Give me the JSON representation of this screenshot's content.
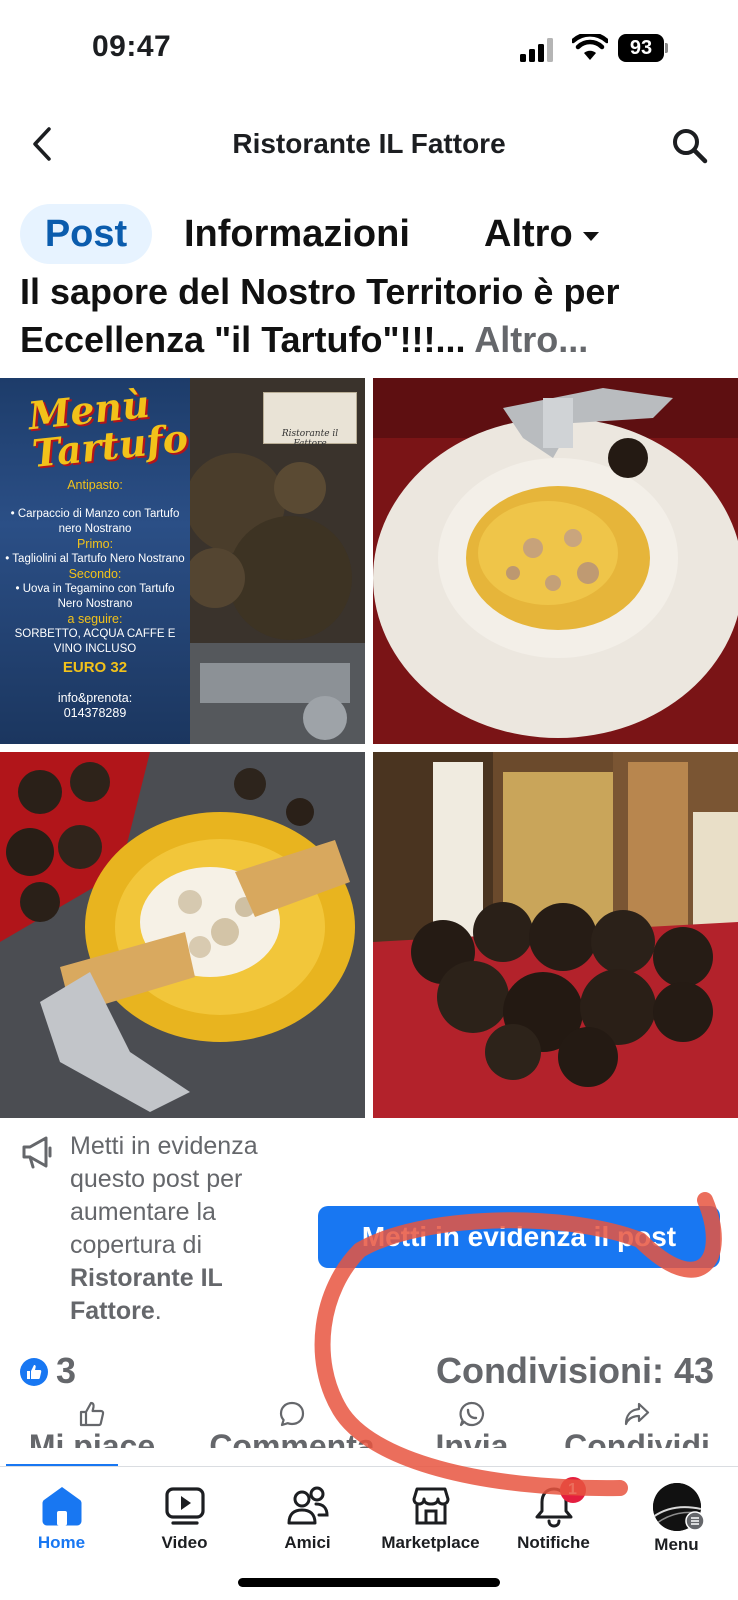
{
  "status_bar": {
    "time": "09:47",
    "battery": "93"
  },
  "header": {
    "title": "Ristorante IL Fattore"
  },
  "tabs": [
    {
      "label": "Post",
      "active": true
    },
    {
      "label": "Informazioni"
    },
    {
      "label": "Altro"
    }
  ],
  "post": {
    "text": "Il sapore del Nostro Territorio è per Eccellenza \"il Tartufo\"!!!...",
    "more_label": "Altro..."
  },
  "poster": {
    "title_line1": "Menù",
    "title_line2": "Tartufo",
    "antipasto_heading": "Antipasto:",
    "antipasto": "• Carpaccio di Manzo con Tartufo nero Nostrano",
    "primo_heading": "Primo:",
    "primo": "• Tagliolini al Tartufo Nero Nostrano",
    "secondo_heading": "Secondo:",
    "secondo": "• Uova in Tegamino con Tartufo Nero Nostrano",
    "seguire_heading": "a seguire:",
    "seguire": "SORBETTO, ACQUA CAFFE E VINO INCLUSO",
    "price": "EURO 32",
    "contact_label": "info&prenota:",
    "phone": "014378289",
    "logo_text": "Ristorante il Fattore"
  },
  "boost": {
    "text_prefix": "Metti in evidenza questo post per aumentare la copertura di",
    "page_name": "Ristorante IL Fattore",
    "text_suffix": ".",
    "button_label": "Metti in evidenza il post"
  },
  "reactions": {
    "likes": "3",
    "shares": "Condivisioni: 43"
  },
  "actions": [
    {
      "label": "Mi piace",
      "icon": "thumbs-up-icon"
    },
    {
      "label": "Commenta",
      "icon": "comment-icon"
    },
    {
      "label": "Invia",
      "icon": "whatsapp-icon"
    },
    {
      "label": "Condividi",
      "icon": "share-icon"
    }
  ],
  "nav": [
    {
      "label": "Home",
      "icon": "home-icon",
      "active": true
    },
    {
      "label": "Video",
      "icon": "video-icon"
    },
    {
      "label": "Amici",
      "icon": "friends-icon"
    },
    {
      "label": "Marketplace",
      "icon": "marketplace-icon"
    },
    {
      "label": "Notifiche",
      "icon": "bell-icon",
      "badge": "1"
    },
    {
      "label": "Menu",
      "icon": "avatar"
    }
  ],
  "colors": {
    "accent": "#1877f2",
    "badge": "#e41e3f",
    "annotation": "#e8553f"
  }
}
